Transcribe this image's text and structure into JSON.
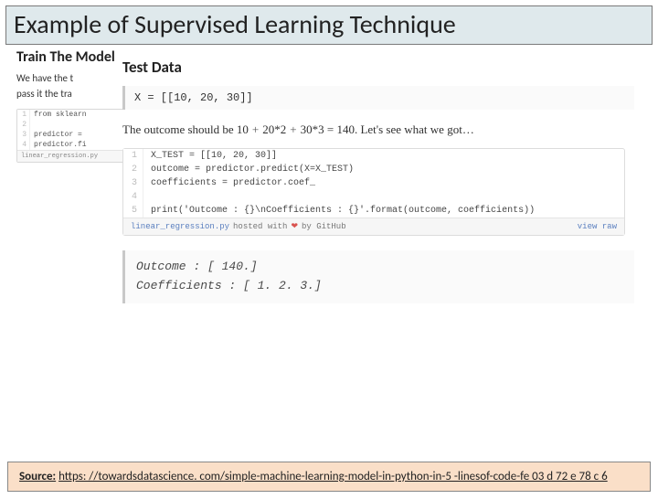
{
  "title": "Example of Supervised Learning Technique",
  "back": {
    "section_title": "Train The Model",
    "section_text_1": "We have the t",
    "section_text_2": "pass it the tra",
    "gist": {
      "lines": [
        "from sklearn",
        "",
        "predictor =",
        "predictor.fi"
      ],
      "footer": "linear_regression.py"
    }
  },
  "front": {
    "section_title": "Test Data",
    "code_inline": "X = [[10, 20, 30]]",
    "expect_prefix": "The outcome should be ",
    "expect_terms": [
      "10",
      "20*2",
      "30*3"
    ],
    "expect_result": " = 140.",
    "expect_tail": " Let's see what we got…",
    "gist": {
      "lines": [
        "X_TEST = [[10, 20, 30]]",
        "outcome = predictor.predict(X=X_TEST)",
        "coefficients = predictor.coef_",
        "",
        "print('Outcome : {}\\nCoefficients : {}'.format(outcome, coefficients))"
      ],
      "footer_file": "linear_regression.py",
      "footer_hosted": "hosted with",
      "footer_by": "by GitHub",
      "footer_viewraw": "view raw"
    },
    "output_line1": "Outcome : [ 140.]",
    "output_line2": "Coefficients : [ 1.  2.  3.]"
  },
  "source": {
    "label": "Source:",
    "url_text": "https: //towardsdatascience. com/simple-machine-learning-model-in-python-in-5 -linesof-code-fe 03 d 72 e 78 c 6"
  }
}
